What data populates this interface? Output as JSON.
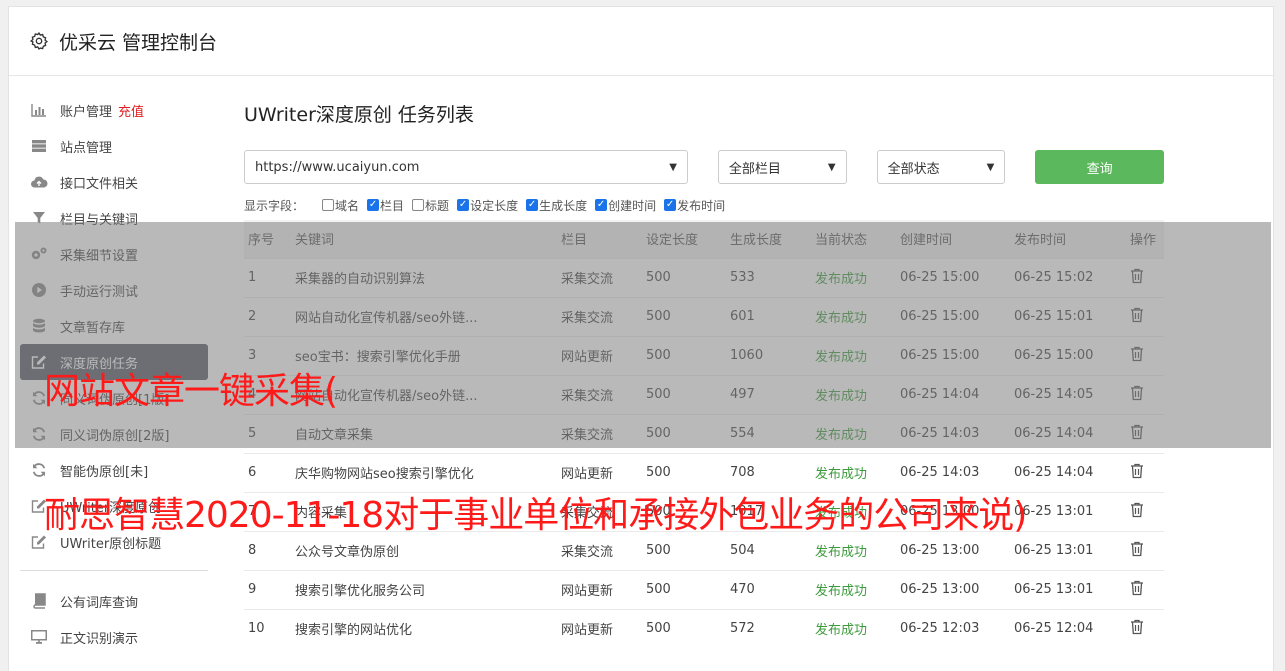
{
  "app": {
    "title": "优采云 管理控制台"
  },
  "sidebar": {
    "items": [
      {
        "label": "账户管理",
        "icon": "bar-chart-icon",
        "extra": "充值"
      },
      {
        "label": "站点管理",
        "icon": "server-icon"
      },
      {
        "label": "接口文件相关",
        "icon": "cloud-upload-icon"
      },
      {
        "label": "栏目与关键词",
        "icon": "filter-icon"
      },
      {
        "label": "采集细节设置",
        "icon": "cogs-icon"
      },
      {
        "label": "手动运行测试",
        "icon": "play-circle-icon"
      },
      {
        "label": "文章暂存库",
        "icon": "database-icon"
      },
      {
        "label": "深度原创任务",
        "icon": "edit-icon",
        "active": true
      },
      {
        "label": "同义词伪原创[1版]",
        "icon": "refresh-icon"
      },
      {
        "label": "同义词伪原创[2版]",
        "icon": "refresh-icon"
      },
      {
        "label": "智能伪原创[未]",
        "icon": "refresh-icon"
      },
      {
        "label": "UWriter深度原创",
        "icon": "edit-icon"
      },
      {
        "label": "UWriter原创标题",
        "icon": "edit-icon"
      }
    ],
    "items2": [
      {
        "label": "公有词库查询",
        "icon": "book-icon"
      },
      {
        "label": "正文识别演示",
        "icon": "monitor-icon"
      }
    ]
  },
  "main": {
    "title": "UWriter深度原创 任务列表",
    "site_select": "https://www.ucaiyun.com",
    "column_select": "全部栏目",
    "status_select": "全部状态",
    "query_label": "查询",
    "fields_label": "显示字段：",
    "fields": [
      {
        "label": "域名",
        "checked": false
      },
      {
        "label": "栏目",
        "checked": true
      },
      {
        "label": "标题",
        "checked": false
      },
      {
        "label": "设定长度",
        "checked": true
      },
      {
        "label": "生成长度",
        "checked": true
      },
      {
        "label": "创建时间",
        "checked": true
      },
      {
        "label": "发布时间",
        "checked": true
      }
    ]
  },
  "table": {
    "headers": [
      "序号",
      "关键词",
      "栏目",
      "设定长度",
      "生成长度",
      "当前状态",
      "创建时间",
      "发布时间",
      "操作"
    ],
    "rows": [
      [
        "1",
        "采集器的自动识别算法",
        "采集交流",
        "500",
        "533",
        "发布成功",
        "06-25 15:00",
        "06-25 15:02"
      ],
      [
        "2",
        "网站自动化宣传机器/seo外链...",
        "采集交流",
        "500",
        "601",
        "发布成功",
        "06-25 15:00",
        "06-25 15:01"
      ],
      [
        "3",
        "seo宝书：搜索引擎优化手册",
        "网站更新",
        "500",
        "1060",
        "发布成功",
        "06-25 15:00",
        "06-25 15:00"
      ],
      [
        "4",
        "网站自动化宣传机器/seo外链...",
        "采集交流",
        "500",
        "497",
        "发布成功",
        "06-25 14:04",
        "06-25 14:05"
      ],
      [
        "5",
        "自动文章采集",
        "采集交流",
        "500",
        "554",
        "发布成功",
        "06-25 14:03",
        "06-25 14:04"
      ],
      [
        "6",
        "庆华购物网站seo搜索引擎优化",
        "网站更新",
        "500",
        "708",
        "发布成功",
        "06-25 14:03",
        "06-25 14:04"
      ],
      [
        "7",
        "内容采集",
        "采集交流",
        "500",
        "1017",
        "发布成功",
        "06-25 13:00",
        "06-25 13:01"
      ],
      [
        "8",
        "公众号文章伪原创",
        "采集交流",
        "500",
        "504",
        "发布成功",
        "06-25 13:00",
        "06-25 13:01"
      ],
      [
        "9",
        "搜索引擎优化服务公司",
        "网站更新",
        "500",
        "470",
        "发布成功",
        "06-25 13:00",
        "06-25 13:01"
      ],
      [
        "10",
        "搜索引擎的网站优化",
        "网站更新",
        "500",
        "572",
        "发布成功",
        "06-25 12:03",
        "06-25 12:04"
      ]
    ]
  },
  "watermark": {
    "line1": "网站文章一键采集(",
    "line2": "耐思智慧2020-11-18对于事业单位和承接外包业务的公司来说)"
  },
  "colors": {
    "success": "#3c9a3c",
    "query_button": "#5cb85c",
    "active_nav": "#545a67",
    "recharge": "#e02020",
    "watermark": "#ff1a1a"
  }
}
